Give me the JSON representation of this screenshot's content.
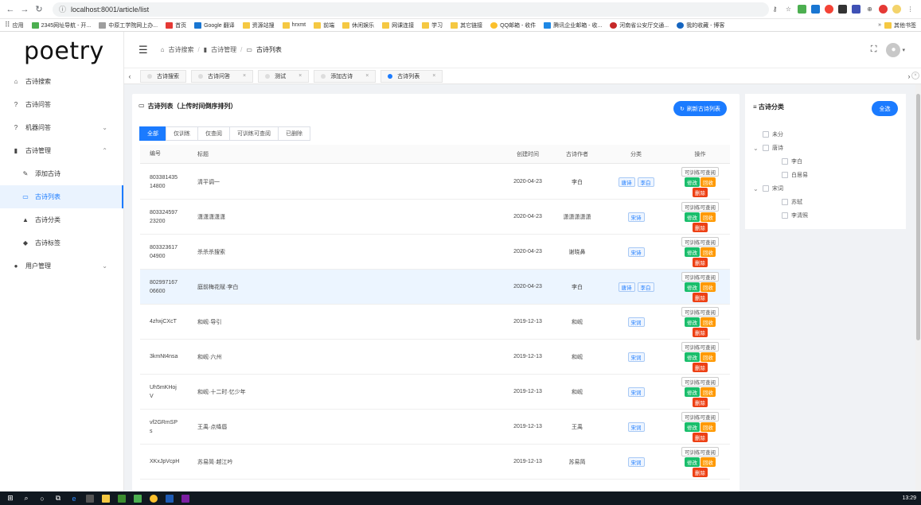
{
  "browser": {
    "url": "localhost:8001/article/list",
    "bookmarks": [
      "应用",
      "2345网址导航 - 开...",
      "中原工学院网上办...",
      "首页",
      "Google 翻译",
      "资源站搜",
      "hrxmt",
      "前端",
      "休闲娱乐",
      "网课连接",
      "学习",
      "其它链接",
      "QQ邮箱 - 收件",
      "腾讯企业邮箱 - 收...",
      "河南省公安厅交通...",
      "我的收藏 - 博客",
      "其他书签"
    ]
  },
  "sidebar": {
    "logo": "poetry",
    "items": [
      {
        "label": "古诗搜索",
        "icon": "⌂"
      },
      {
        "label": "古诗问答",
        "icon": "?"
      },
      {
        "label": "机器问答",
        "icon": "?",
        "chevron": "⌄"
      },
      {
        "label": "古诗管理",
        "icon": "▮",
        "chevron": "⌃"
      },
      {
        "label": "添加古诗",
        "icon": "✎"
      },
      {
        "label": "古诗列表",
        "icon": "▭"
      },
      {
        "label": "古诗分类",
        "icon": "▲"
      },
      {
        "label": "古诗标签",
        "icon": "◆"
      },
      {
        "label": "用户管理",
        "icon": "●",
        "chevron": "⌄"
      }
    ]
  },
  "header": {
    "breadcrumb": [
      "古诗搜索",
      "古诗管理",
      "古诗列表"
    ]
  },
  "tabs": [
    "古诗搜索",
    "古诗问答",
    "测试",
    "添加古诗",
    "古诗列表"
  ],
  "list": {
    "title": "古诗列表（上传时间倒序排列）",
    "refresh_label": "刷新古诗列表",
    "filters": [
      "全部",
      "仅训练",
      "仅查阅",
      "可训练可查阅",
      "已删除"
    ],
    "columns": [
      "编号",
      "标题",
      "创建时间",
      "古诗作者",
      "分类",
      "操作"
    ],
    "ops": {
      "train": "可训练可查阅",
      "edit": "修改",
      "back": "回收",
      "del": "删除"
    },
    "rows": [
      {
        "id1": "803381435",
        "id2": "14800",
        "title": "清平调一",
        "date": "2020-04-23",
        "author": "李白",
        "tags": [
          "唐诗",
          "李白"
        ]
      },
      {
        "id1": "803324597",
        "id2": "23200",
        "title": "潇潇潇潇潇",
        "date": "2020-04-23",
        "author": "潇潇潇潇潇",
        "tags": [
          "宋诗"
        ]
      },
      {
        "id1": "803323617",
        "id2": "04900",
        "title": "杀杀杀搜索",
        "date": "2020-04-23",
        "author": "谢晓鼻",
        "tags": [
          "宋诗"
        ]
      },
      {
        "id1": "802997167",
        "id2": "06600",
        "title": "庭前梅花赋·李白",
        "date": "2020-04-23",
        "author": "李白",
        "tags": [
          "唐诗",
          "李白"
        ]
      },
      {
        "id1": "4zhxjCXcT",
        "id2": "",
        "title": "和岘·导引",
        "date": "2019-12-13",
        "author": "和岘",
        "tags": [
          "宋词"
        ]
      },
      {
        "id1": "3kmNt4nsa",
        "id2": "",
        "title": "和岘·六州",
        "date": "2019-12-13",
        "author": "和岘",
        "tags": [
          "宋词"
        ]
      },
      {
        "id1": "Uh5mKHoj",
        "id2": "V",
        "title": "和岘·十二时·忆少年",
        "date": "2019-12-13",
        "author": "和岘",
        "tags": [
          "宋词"
        ]
      },
      {
        "id1": "vf2GRmSP",
        "id2": "s",
        "title": "王禹·点绛唇",
        "date": "2019-12-13",
        "author": "王禹",
        "tags": [
          "宋词"
        ]
      },
      {
        "id1": "XKxJpVcpH",
        "id2": "",
        "title": "苏易简·越江吟",
        "date": "2019-12-13",
        "author": "苏易简",
        "tags": [
          "宋词"
        ]
      }
    ]
  },
  "category": {
    "title": "古诗分类",
    "select_all": "全选",
    "tree": [
      {
        "label": "未分",
        "level": 0,
        "arrow": ""
      },
      {
        "label": "唐诗",
        "level": 0,
        "arrow": "⌄"
      },
      {
        "label": "李白",
        "level": 1,
        "arrow": ""
      },
      {
        "label": "白居易",
        "level": 1,
        "arrow": ""
      },
      {
        "label": "宋词",
        "level": 0,
        "arrow": "⌄"
      },
      {
        "label": "苏轼",
        "level": 1,
        "arrow": ""
      },
      {
        "label": "李清照",
        "level": 1,
        "arrow": ""
      }
    ]
  },
  "taskbar": {
    "clock": "13:29"
  }
}
